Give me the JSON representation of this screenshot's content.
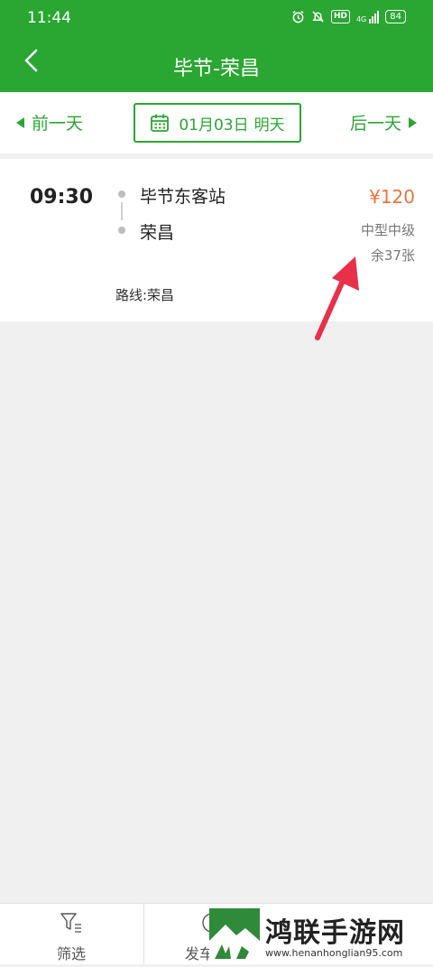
{
  "status_bar": {
    "time": "11:44",
    "icons": [
      "alarm-icon",
      "mute-icon",
      "hd-icon",
      "signal-4g-icon",
      "battery-icon"
    ],
    "hd": "HD",
    "network": "4G",
    "battery": "84"
  },
  "header": {
    "title": "毕节-荣昌",
    "back_icon": "chevron-left-icon"
  },
  "date_bar": {
    "prev_label": "前一天",
    "next_label": "后一天",
    "date": "01月03日",
    "day_label": "明天"
  },
  "trip": {
    "time": "09:30",
    "from": "毕节东客站",
    "to": "荣昌",
    "price": "¥120",
    "bus_type": "中型中级",
    "seats": "余37张",
    "route": "路线:荣昌"
  },
  "bottom_bar": {
    "filter_label": "筛选",
    "depart_label": "发车"
  },
  "watermark": {
    "text": "鸿联手游网",
    "url": "www.henanhonglian95.com"
  },
  "colors": {
    "brand": "#2aa632",
    "price": "#e8743b",
    "annotation_arrow": "#e8304a"
  }
}
